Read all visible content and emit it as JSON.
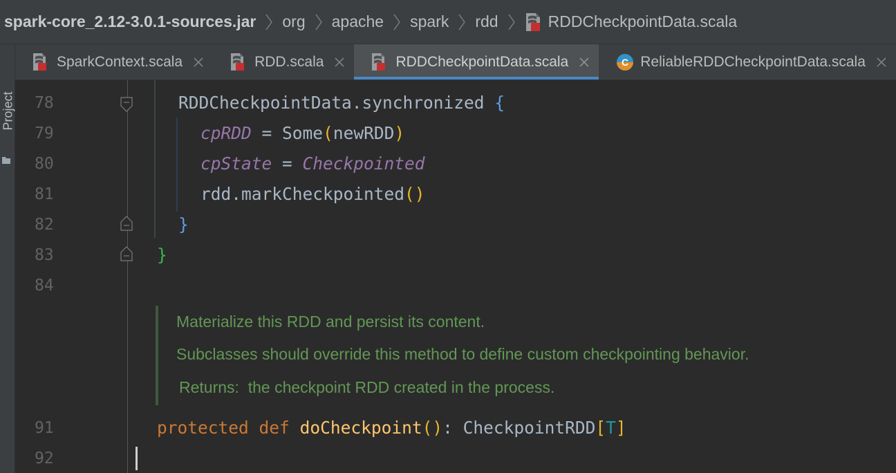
{
  "breadcrumb": {
    "items": [
      "spark-core_2.12-3.0.1-sources.jar",
      "org",
      "apache",
      "spark",
      "rdd",
      "RDDCheckpointData.scala"
    ]
  },
  "sidebar": {
    "label": "Project"
  },
  "tabs": [
    {
      "label": "SparkContext.scala",
      "icon": "scala-file-icon",
      "active": false
    },
    {
      "label": "RDD.scala",
      "icon": "scala-file-icon",
      "active": false
    },
    {
      "label": "RDDCheckpointData.scala",
      "icon": "scala-file-icon",
      "active": true
    },
    {
      "label": "ReliableRDDCheckpointData.scala",
      "icon": "scala-class-icon",
      "active": false
    }
  ],
  "editor": {
    "line_numbers": [
      "78",
      "79",
      "80",
      "81",
      "82",
      "83",
      "84",
      "91",
      "92"
    ],
    "lines": {
      "l78": {
        "obj": "RDDCheckpointData",
        "dot": ".",
        "method": "synchronized",
        "sp": " ",
        "brace": "{"
      },
      "l79": {
        "field": "cpRDD",
        "eq": " = ",
        "ctor": "Some",
        "lp": "(",
        "arg": "newRDD",
        "rp": ")"
      },
      "l80": {
        "field": "cpState",
        "eq": " = ",
        "value": "Checkpointed"
      },
      "l81": {
        "obj": "rdd",
        "dot": ".",
        "method": "markCheckpointed",
        "parens": "()"
      },
      "l82": {
        "brace": "}"
      },
      "l83": {
        "brace": "}"
      },
      "l91": {
        "kw1": "protected",
        "sp1": " ",
        "kw2": "def",
        "sp2": " ",
        "fn": "doCheckpoint",
        "parens": "()",
        "colon": ": ",
        "type": "CheckpointRDD",
        "lb": "[",
        "tparam": "T",
        "rb": "]"
      }
    },
    "doc": {
      "line1": "Materialize this RDD and persist its content.",
      "line2": "Subclasses should override this method to define custom checkpointing behavior.",
      "returns_label": "Returns:",
      "returns_text": "the checkpoint RDD created in the process."
    }
  },
  "colors": {
    "keyword": "#cc7832",
    "function": "#ffc66d",
    "field": "#9876aa",
    "doc": "#629755",
    "accent": "#4a88c7"
  }
}
